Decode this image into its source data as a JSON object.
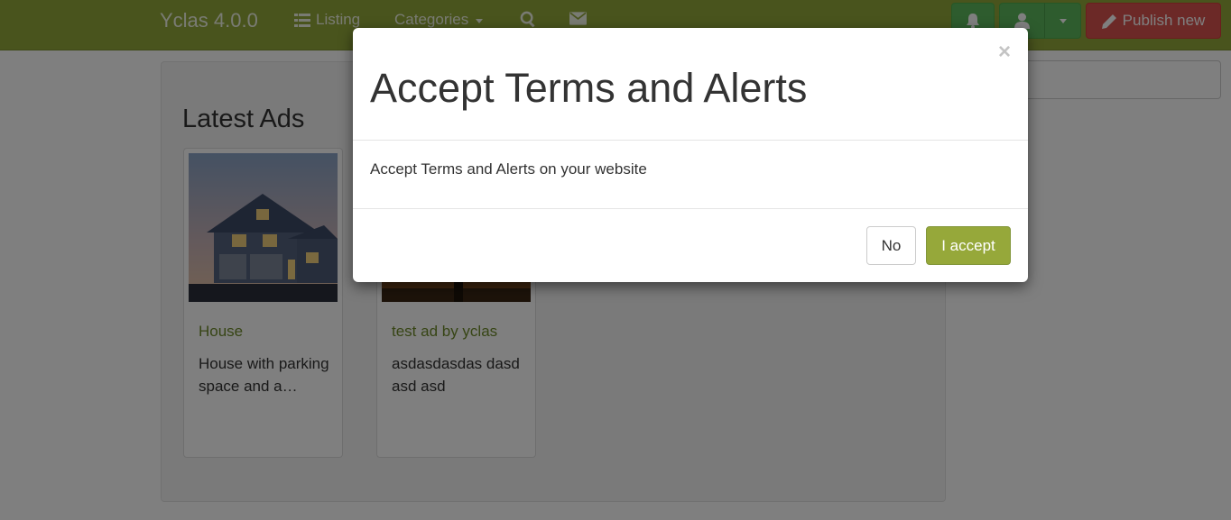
{
  "navbar": {
    "brand": "Yclas 4.0.0",
    "listing_label": "Listing",
    "categories_label": "Categories",
    "publish_label": "Publish new"
  },
  "search": {
    "placeholder": "Search"
  },
  "main": {
    "section_title": "Latest Ads",
    "ads": [
      {
        "title": "House",
        "description": "House with parking space and a…"
      },
      {
        "title": "test ad by yclas",
        "description": "asdasdasdas dasd asd asd"
      }
    ]
  },
  "modal": {
    "title": "Accept Terms and Alerts",
    "close_label": "×",
    "body": "Accept Terms and Alerts on your website",
    "no_label": "No",
    "accept_label": "I accept"
  },
  "icons": {
    "listing": "list-icon",
    "search": "search-icon",
    "contact": "envelope-icon",
    "notifications": "bell-icon",
    "user": "user-icon",
    "dropdown": "caret-down-icon",
    "publish": "pencil-icon",
    "close": "close-icon"
  },
  "colors": {
    "navbar": "#93a83b",
    "success_button": "#5cb85c",
    "danger_button": "#d9534f",
    "accept_button": "#96a83a",
    "ad_title": "#6e8a2a"
  }
}
